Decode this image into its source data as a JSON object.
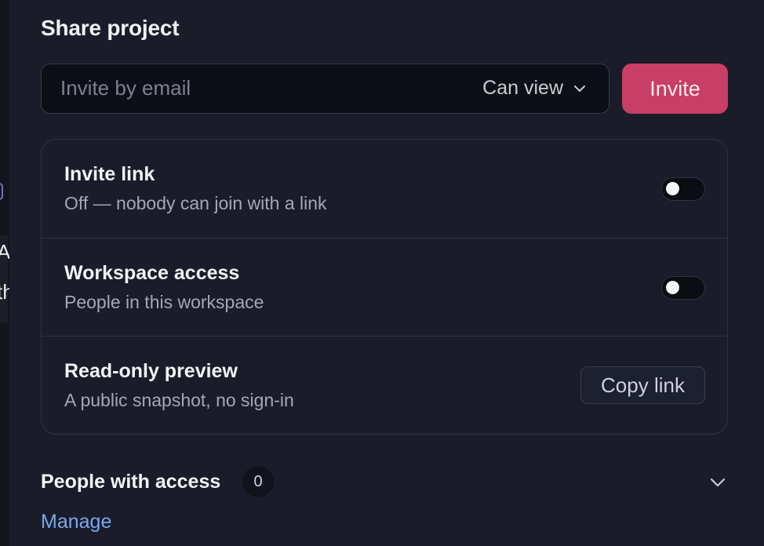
{
  "share": {
    "title": "Share project",
    "email_placeholder": "Invite by email",
    "email_value": "",
    "permission_selected": "Can view",
    "invite_label": "Invite"
  },
  "settings": {
    "invite_link": {
      "title": "Invite link",
      "subtitle": "Off — nobody can join with a link",
      "enabled": false
    },
    "workspace_access": {
      "title": "Workspace access",
      "subtitle": "People in this workspace",
      "enabled": false
    },
    "readonly_preview": {
      "title": "Read-only preview",
      "subtitle": "A public snapshot, no sign-in",
      "button_label": "Copy link"
    }
  },
  "people": {
    "label": "People with access",
    "count": "0",
    "manage_label": "Manage"
  },
  "backdrop": {
    "text_1": "A",
    "text_2": "th"
  },
  "icons": {
    "permission": "chevron-down-icon",
    "people_expand": "chevron-down-icon"
  },
  "colors": {
    "accent": "#c93e64",
    "link": "#7aa6ee",
    "background": "#1a1d29"
  }
}
